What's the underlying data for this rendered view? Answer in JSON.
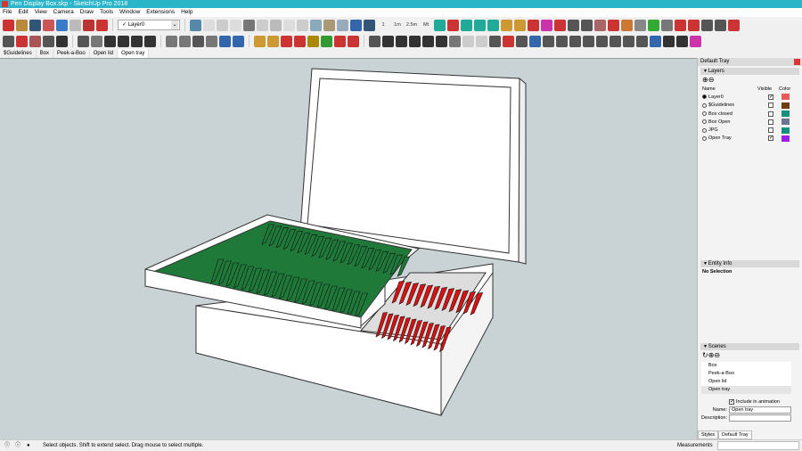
{
  "window": {
    "title": "Pen Display Box.skp - SketchUp Pro 2018"
  },
  "menu": [
    "File",
    "Edit",
    "View",
    "Camera",
    "Draw",
    "Tools",
    "Window",
    "Extensions",
    "Help"
  ],
  "toolbar1": {
    "left_icons": [
      [
        "new-file-icon",
        "#c33"
      ],
      [
        "open-folder-icon",
        "#b88a3a"
      ],
      [
        "save-icon",
        "#357"
      ],
      [
        "save-as-icon",
        "#c55"
      ],
      [
        "undo-icon",
        "#3a7bc8"
      ],
      [
        "redo-icon",
        "#bbb"
      ],
      [
        "print-icon",
        "#b33"
      ],
      [
        "model-info-icon",
        "#c33"
      ]
    ],
    "layer_select": "Layer0",
    "right_icons": [
      [
        "iso-view-icon",
        "#58a"
      ],
      [
        "top-view-icon",
        "#ddd"
      ],
      [
        "front-view-icon",
        "#ccc"
      ],
      [
        "right-view-icon",
        "#ddd"
      ],
      [
        "back-view-icon",
        "#777"
      ],
      [
        "left-view-icon",
        "#ccc"
      ],
      [
        "xray-icon",
        "#bbb"
      ],
      [
        "wireframe-icon",
        "#ddd"
      ],
      [
        "hidden-line-icon",
        "#ccc"
      ],
      [
        "shaded-icon",
        "#8ab"
      ],
      [
        "textured-icon",
        "#a97"
      ],
      [
        "monochrome-icon",
        "#9ab"
      ],
      [
        "section-icon",
        "#36a"
      ],
      [
        "globe-icon",
        "#357"
      ]
    ],
    "text_buttons": [
      "1",
      "1m",
      "2.5m",
      "Mt"
    ],
    "tail_icons": [
      [
        "sandbox-1-icon",
        "#2a9"
      ],
      [
        "sandbox-2-icon",
        "#c33"
      ],
      [
        "layers-stack-icon",
        "#2a9"
      ],
      [
        "layers-2-icon",
        "#2a9"
      ],
      [
        "layers-3-icon",
        "#2a9"
      ],
      [
        "chart-icon",
        "#c93"
      ],
      [
        "pencil-icon",
        "#c93"
      ],
      [
        "paint-icon",
        "#c33"
      ],
      [
        "flip-icon",
        "#c3a"
      ],
      [
        "scale-icon",
        "#c33"
      ],
      [
        "shield-icon",
        "#555"
      ],
      [
        "shield-2-icon",
        "#555"
      ],
      [
        "hat-icon",
        "#a66"
      ],
      [
        "box-red-icon",
        "#c33"
      ],
      [
        "cube-icon",
        "#c73"
      ],
      [
        "lines-icon",
        "#888"
      ],
      [
        "tree-icon",
        "#3a3"
      ],
      [
        "sphere-icon",
        "#777"
      ],
      [
        "component-icon",
        "#c33"
      ],
      [
        "scale-2-icon",
        "#c33"
      ],
      [
        "grid-icon",
        "#555"
      ],
      [
        "grid-2-icon",
        "#555"
      ],
      [
        "close-icon",
        "#c33"
      ]
    ]
  },
  "toolbar2": {
    "icons": [
      [
        "select-icon",
        "#555"
      ],
      [
        "move-icon",
        "#c33"
      ],
      [
        "paint-bucket-icon",
        "#a55"
      ],
      [
        "orbit-icon",
        "#555"
      ],
      [
        "walk-icon",
        "#333"
      ],
      [
        "component-icon",
        "#555"
      ],
      [
        "box-icon",
        "#777"
      ],
      [
        "house-1-icon",
        "#333"
      ],
      [
        "house-2-icon",
        "#333"
      ],
      [
        "house-3-icon",
        "#333"
      ],
      [
        "house-4-icon",
        "#333"
      ],
      [
        "shadow-1-icon",
        "#777"
      ],
      [
        "shadow-2-icon",
        "#777"
      ],
      [
        "shadow-3-icon",
        "#555"
      ],
      [
        "shadow-4-icon",
        "#777"
      ],
      [
        "shadow-5-icon",
        "#36a"
      ],
      [
        "shadow-6-icon",
        "#36a"
      ],
      [
        "camera-icon",
        "#c93"
      ],
      [
        "ruler-icon",
        "#c93"
      ],
      [
        "trees-icon",
        "#c33"
      ],
      [
        "tree-2-icon",
        "#c33"
      ],
      [
        "cube-2-icon",
        "#a80"
      ],
      [
        "sandbox-icon",
        "#393"
      ],
      [
        "tree-3-icon",
        "#c33"
      ],
      [
        "axis-icon",
        "#c33"
      ],
      [
        "dims-icon",
        "#555"
      ],
      [
        "home-1-icon",
        "#333"
      ],
      [
        "home-2-icon",
        "#333"
      ],
      [
        "home-3-icon",
        "#333"
      ],
      [
        "home-4-icon",
        "#333"
      ],
      [
        "home-5-icon",
        "#333"
      ],
      [
        "rect-icon",
        "#777"
      ],
      [
        "page-icon",
        "#ccc"
      ],
      [
        "copy-icon",
        "#ccc"
      ],
      [
        "warehouse-icon",
        "#555"
      ],
      [
        "ext-icon",
        "#c33"
      ],
      [
        "lasso-icon",
        "#555"
      ],
      [
        "arc-icon",
        "#36a"
      ],
      [
        "spiral-1-icon",
        "#555"
      ],
      [
        "spiral-2-icon",
        "#555"
      ],
      [
        "spiral-3-icon",
        "#555"
      ],
      [
        "spiral-4-icon",
        "#555"
      ],
      [
        "spiral-5-icon",
        "#555"
      ],
      [
        "spiral-6-icon",
        "#555"
      ],
      [
        "curve-icon",
        "#555"
      ],
      [
        "curve-2-icon",
        "#555"
      ],
      [
        "scale-icon",
        "#36a"
      ],
      [
        "lock-icon",
        "#333"
      ],
      [
        "filter-icon",
        "#333"
      ],
      [
        "tag-icon",
        "#c3a"
      ]
    ]
  },
  "scene_tabs": [
    "$Guidelines",
    "Box",
    "Peek-a-Boo",
    "Open lid",
    "Open tray"
  ],
  "active_scene_tab": "Open tray",
  "tray": {
    "title": "Default Tray",
    "layers": {
      "title": "Layers",
      "col_name": "Name",
      "col_visible": "Visible",
      "col_color": "Color",
      "rows": [
        {
          "name": "Layer0",
          "active": true,
          "visible": true,
          "color": "#e85a5a"
        },
        {
          "name": "$Guidelines",
          "active": false,
          "visible": false,
          "color": "#6b3d10"
        },
        {
          "name": "Box closed",
          "active": false,
          "visible": false,
          "color": "#1b8f7d"
        },
        {
          "name": "Box Open",
          "active": false,
          "visible": false,
          "color": "#6e7394"
        },
        {
          "name": "JPG",
          "active": false,
          "visible": false,
          "color": "#169180"
        },
        {
          "name": "Open Tray",
          "active": false,
          "visible": true,
          "color": "#9a1ee8"
        }
      ]
    },
    "entity_info": {
      "title": "Entity Info",
      "selection": "No Selection"
    },
    "scenes": {
      "title": "Scenes",
      "items": [
        "Box",
        "Peek-a-Boo",
        "Open lid",
        "Open tray"
      ],
      "current": "Open tray",
      "include_label": "Include in animation",
      "include_checked": true,
      "name_label": "Name:",
      "name_value": "Open tray",
      "description_label": "Description:",
      "description_value": ""
    },
    "bottom_tabs": [
      "Styles",
      "Default Tray"
    ]
  },
  "status": {
    "text": "Select objects. Shift to extend select. Drag mouse to select multiple.",
    "measurements_label": "Measurements"
  },
  "colors": {
    "title_bar": "#2bb5c8",
    "viewport": "#c9d3d5",
    "slots_green": "#1f7a3a",
    "slots_red": "#e01010"
  }
}
